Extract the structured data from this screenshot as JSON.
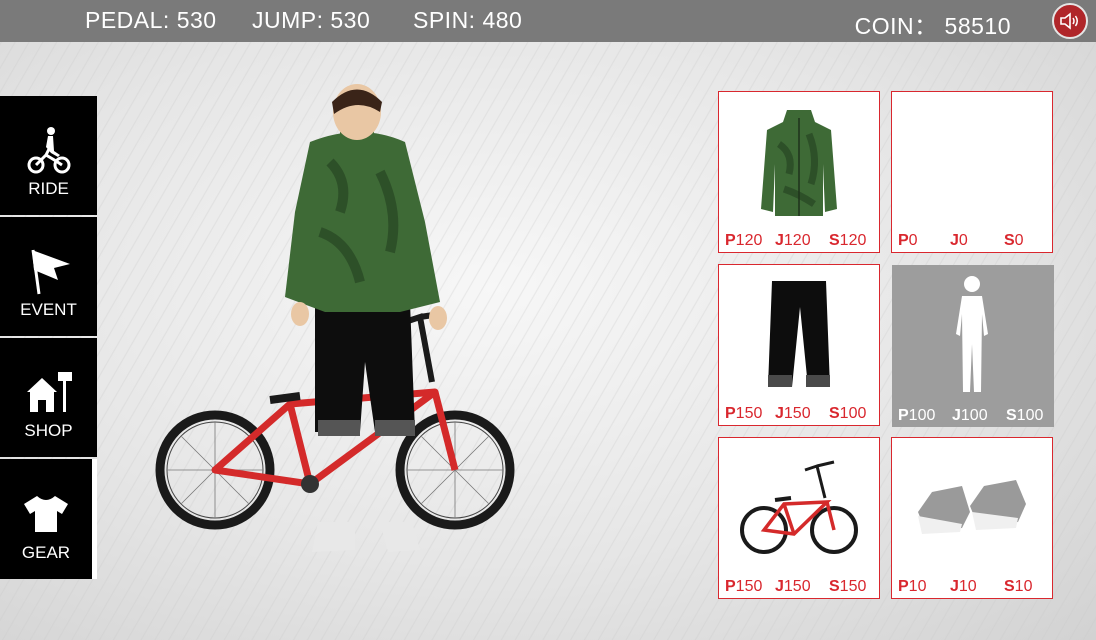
{
  "topbar": {
    "pedal": "PEDAL: 530",
    "jump": "JUMP: 530",
    "spin": "SPIN: 480",
    "coin": "COIN： 58510",
    "sound_icon": "speaker-icon"
  },
  "sidebar": {
    "items": [
      {
        "label": "RIDE",
        "icon": "cyclist-icon",
        "active": false
      },
      {
        "label": "EVENT",
        "icon": "flag-icon",
        "active": false
      },
      {
        "label": "SHOP",
        "icon": "house-sign-icon",
        "active": false
      },
      {
        "label": "GEAR",
        "icon": "tshirt-icon",
        "active": true
      }
    ]
  },
  "colors": {
    "accent": "#d9272e",
    "topbar": "#7a7a7a",
    "sidebar": "#000000",
    "locked_cell": "#9d9d9d"
  },
  "gear": [
    {
      "slot": "jacket",
      "p": "120",
      "j": "120",
      "s": "120",
      "locked": false
    },
    {
      "slot": "empty",
      "p": "0",
      "j": "0",
      "s": "0",
      "locked": false
    },
    {
      "slot": "pants",
      "p": "150",
      "j": "150",
      "s": "100",
      "locked": false
    },
    {
      "slot": "body-silhouette",
      "p": "100",
      "j": "100",
      "s": "100",
      "locked": true
    },
    {
      "slot": "bike",
      "p": "150",
      "j": "150",
      "s": "150",
      "locked": false
    },
    {
      "slot": "shoes",
      "p": "10",
      "j": "10",
      "s": "10",
      "locked": false
    }
  ],
  "stat_letters": {
    "p": "P",
    "j": "J",
    "s": "S"
  }
}
